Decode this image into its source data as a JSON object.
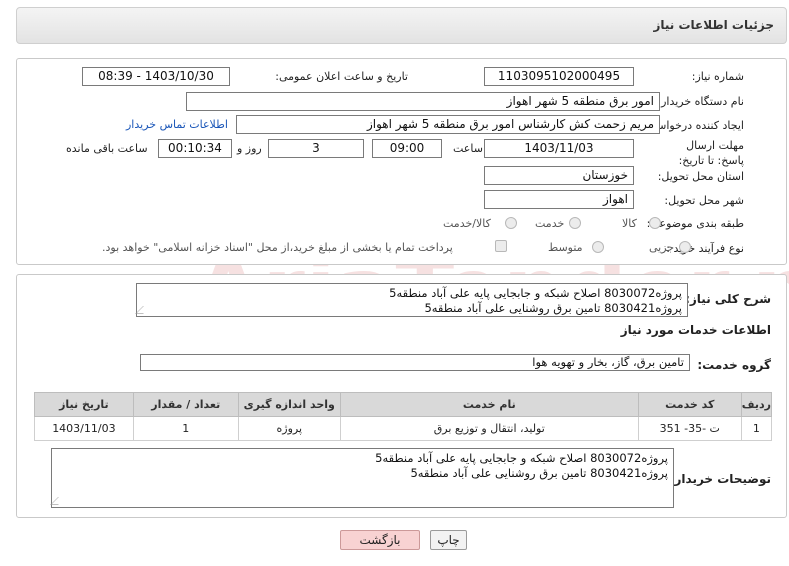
{
  "title": "جزئیات اطلاعات نیاز",
  "watermark": "AriaTender.neT",
  "form": {
    "need_number_label": "شماره نیاز:",
    "need_number": "1103095102000495",
    "announce_label": "تاریخ و ساعت اعلان عمومی:",
    "announce_value": "1403/10/30 - 08:39",
    "buyer_org_label": "نام دستگاه خریدار:",
    "buyer_org": "امور برق منطقه 5 شهر اهواز",
    "creator_label": "ایجاد کننده درخواست:",
    "creator": "مریم زحمت کش کارشناس امور برق منطقه 5 شهر اهواز",
    "contact_link": "اطلاعات تماس خریدار",
    "deadline_label": "مهلت ارسال پاسخ: تا تاریخ:",
    "deadline_date": "1403/11/03",
    "time_label": "ساعت",
    "deadline_time": "09:00",
    "days_value": "3",
    "days_label": "روز و",
    "remaining_time": "00:10:34",
    "remaining_label": "ساعت باقی مانده",
    "province_label": "استان محل تحویل:",
    "province": "خوزستان",
    "city_label": "شهر محل تحویل:",
    "city": "اهواز",
    "category_label": "طبقه بندی موضوعی:",
    "category_options": [
      "کالا",
      "خدمت",
      "کالا/خدمت"
    ],
    "process_label": "نوع فرآیند خرید :",
    "process_options": [
      "جزیی",
      "متوسط"
    ],
    "treasury_note": "پرداخت تمام یا بخشی از مبلغ خرید،از محل \"اسناد خزانه اسلامی\" خواهد بود."
  },
  "summary": {
    "label": "شرح کلی نیاز:",
    "lines": [
      "پروژه8030072 اصلاح شبکه و جابجایی پایه علی آباد منطقه5",
      "پروژه8030421 تامین برق روشنایی علی آباد منطقه5"
    ]
  },
  "services": {
    "heading": "اطلاعات خدمات مورد نیاز",
    "group_label": "گروه خدمت:",
    "group_value": "تامین برق، گاز، بخار و تهویه هوا",
    "columns": [
      "ردیف",
      "کد خدمت",
      "نام خدمت",
      "واحد اندازه گیری",
      "تعداد / مقدار",
      "تاریخ نیاز"
    ],
    "rows": [
      [
        "1",
        "ت -35- 351",
        "تولید، انتقال و توزیع برق",
        "پروژه",
        "1",
        "1403/11/03"
      ]
    ]
  },
  "buyer_notes": {
    "label": "توضیحات خریدار:",
    "lines": [
      "پروژه8030072 اصلاح شبکه و جابجایی پایه علی آباد منطقه5",
      "پروژه8030421 تامین برق روشنایی علی آباد منطقه5"
    ]
  },
  "buttons": {
    "print": "چاپ",
    "back": "بازگشت"
  }
}
